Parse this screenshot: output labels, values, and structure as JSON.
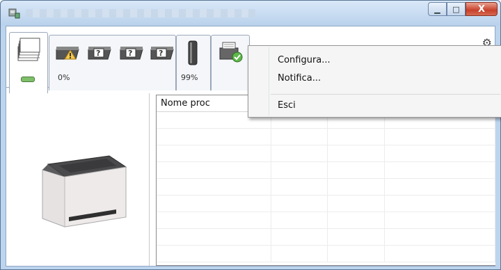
{
  "window": {
    "title_obscured": ""
  },
  "caption": {
    "minimize": "▁",
    "maximize": "□",
    "close": "X"
  },
  "tabs": {
    "toner_pct": "0%",
    "waste_pct": "99%",
    "icons": [
      "stack-pages-icon",
      "toner-warning-icon",
      "toner-unknown-icon",
      "toner-unknown-icon",
      "toner-unknown-icon",
      "waste-bottle-icon",
      "printer-status-icon"
    ]
  },
  "table": {
    "columns": [
      "Nome proc",
      "",
      "",
      ""
    ],
    "rows": 8
  },
  "context_menu": {
    "items": [
      "Configura...",
      "Notifica...",
      "Esci"
    ]
  }
}
